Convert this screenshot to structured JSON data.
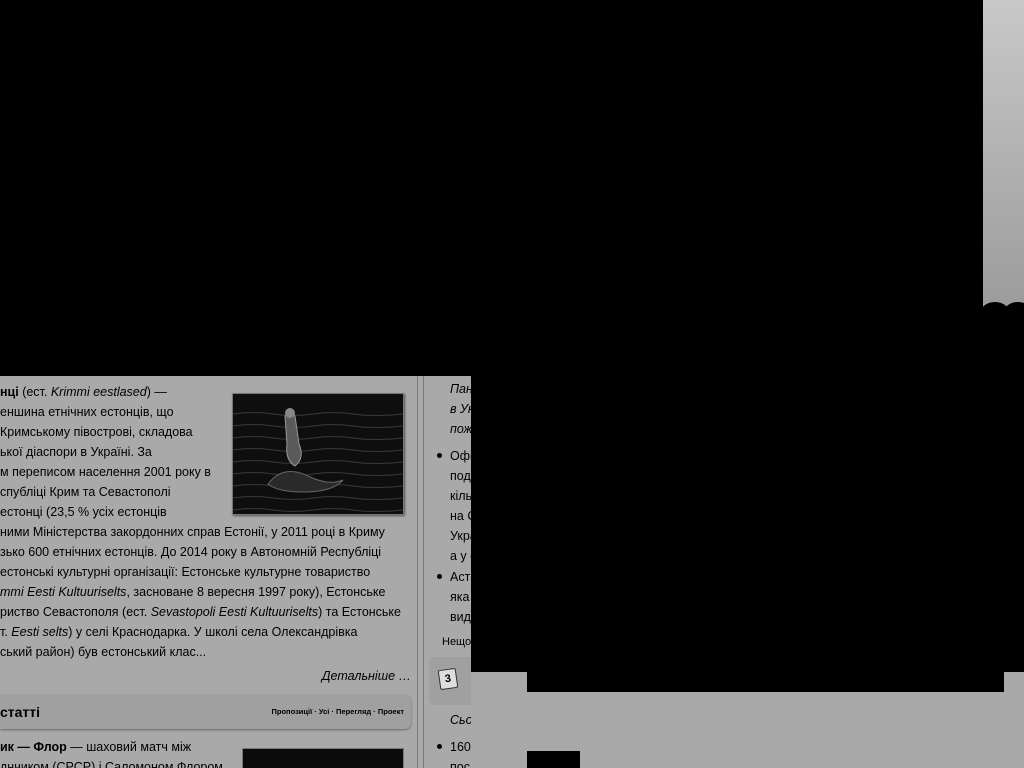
{
  "article": {
    "lines": [
      [
        "нці",
        " (ест. ",
        "Krimmi eestlased",
        ") —"
      ],
      "еншина етнічних естонців, що",
      " Кримському півострові, складова",
      "ької діаспори в Україні. За",
      "м переписом населення 2001 року в",
      "спубліці Крим та Севастополі",
      " естонці (23,5 % усіх естонців",
      "ними Міністерства закордонних справ Естонії, у 2011 році в Криму",
      "зько 600 етнічних естонців. До 2014 року в Автономній Республіці",
      " естонські культурні організації: Естонське культурне товариство",
      [
        "mmi Eesti Kultuuriselts",
        ", засноване 8 вересня 1997 року), Естонське"
      ],
      [
        "риство Севастополя (ест. ",
        "Sevastopoli Eesti Kultuuriselts",
        ") та Естонське"
      ],
      [
        "т. ",
        "Eesti selts",
        ") у селі Краснодарка. У школі села Олександрівка"
      ],
      "ський район) був естонський клас..."
    ],
    "more_link": "Детальніше …",
    "photo_alt": "mermaid-statue-photo"
  },
  "section_header": {
    "title": "статті",
    "links": [
      "Пропозиції",
      "Усі",
      "Перегляд",
      "Проект"
    ]
  },
  "chess": {
    "line1_bold": "ик — Флор",
    "line1_rest": " — шаховий матч між",
    "line2": "днчиком (СРСР) і Саломоном Флором"
  },
  "right_column": {
    "lines": [
      "Пан",
      "в Ук",
      "пож"
    ],
    "bullet1": [
      "Офі",
      "под",
      "кіль",
      "на С",
      "Укра",
      "а у с"
    ],
    "bullet2": [
      "Астр",
      "яка",
      "вид"
    ],
    "footer": "Нещо",
    "calendar_day": "3",
    "today": "Сьо",
    "bullet3": [
      "160",
      "пос"
    ]
  }
}
